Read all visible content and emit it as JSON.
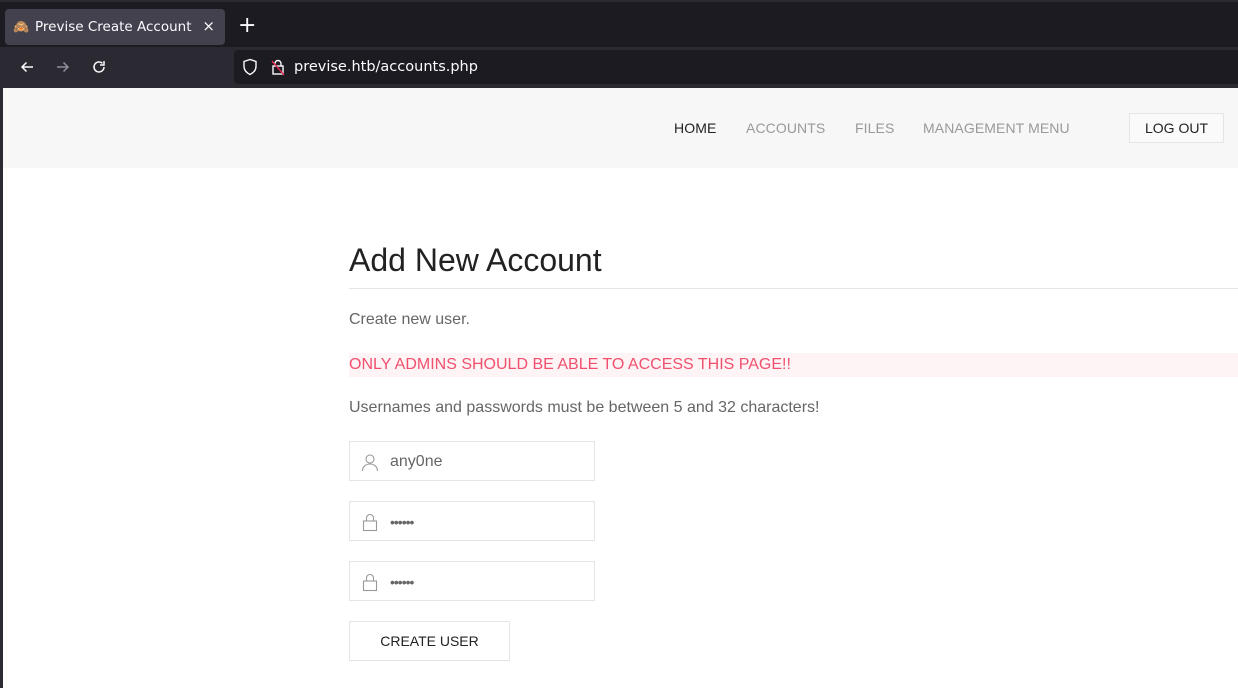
{
  "browser": {
    "tab_title": "Previse Create Account",
    "favicon": "🙈",
    "close_glyph": "×",
    "new_tab_glyph": "+",
    "url": "previse.htb/accounts.php"
  },
  "nav": {
    "items": [
      {
        "label": "HOME",
        "active": true
      },
      {
        "label": "ACCOUNTS",
        "active": false
      },
      {
        "label": "FILES",
        "active": false
      },
      {
        "label": "MANAGEMENT MENU",
        "active": false
      }
    ],
    "logout_label": "LOG OUT"
  },
  "page": {
    "title": "Add New Account",
    "subtitle": "Create new user.",
    "warning": "ONLY ADMINS SHOULD BE ABLE TO ACCESS THIS PAGE!!",
    "rule_text": "Usernames and passwords must be between 5 and 32 characters!"
  },
  "form": {
    "username_value": "any0ne",
    "password_value": "••••••",
    "confirm_value": "••••••",
    "submit_label": "CREATE USER"
  },
  "colors": {
    "warning_text": "#f0506e",
    "warning_bg": "#fef4f6",
    "nav_active": "#222222",
    "nav_inactive": "#999999"
  }
}
